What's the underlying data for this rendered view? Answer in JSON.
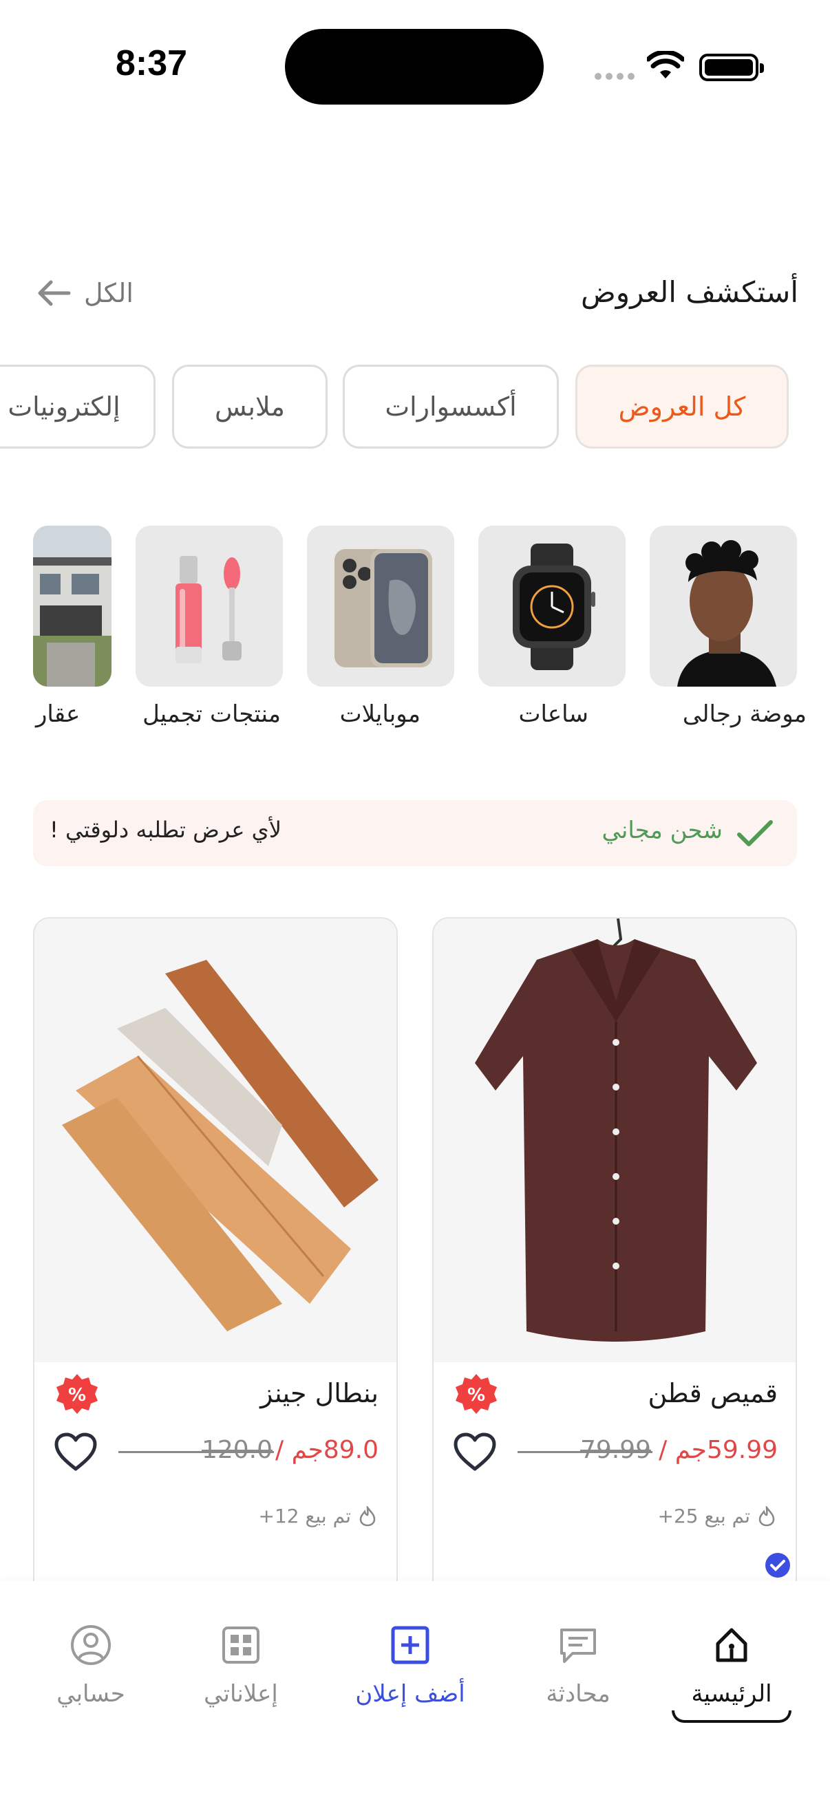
{
  "status_bar": {
    "time": "8:37"
  },
  "header": {
    "title": "أستكشف العروض",
    "see_all": "الكل"
  },
  "filters": [
    {
      "label": "كل العروض",
      "active": true
    },
    {
      "label": "أكسسوارات",
      "active": false
    },
    {
      "label": "ملابس",
      "active": false
    },
    {
      "label": "إلكترونيات",
      "active": false
    }
  ],
  "categories": [
    {
      "label": "موضة رجالى",
      "icon": "man-portrait"
    },
    {
      "label": "ساعات",
      "icon": "smart-watch"
    },
    {
      "label": "موبايلات",
      "icon": "smartphone"
    },
    {
      "label": "منتجات تجميل",
      "icon": "lip-gloss"
    },
    {
      "label": "عقار",
      "icon": "house"
    }
  ],
  "banner": {
    "title": "شحن مجاني",
    "subtitle": "لأي عرض تطلبه دلوقتي !"
  },
  "products": [
    {
      "name": "قميص قطن",
      "price": "59.99جم /",
      "old_price": "79.99",
      "sold": "تم بيع 25+",
      "image": "brown-shirt"
    },
    {
      "name": "بنطال جينز",
      "price": "89.0جم /",
      "old_price": "120.0",
      "sold": "تم بيع 12+",
      "image": "folded-pants"
    }
  ],
  "nav": {
    "home": "الرئيسية",
    "chat": "محادثة",
    "add": "أضف إعلان",
    "my_ads": "إعلاناتي",
    "account": "حسابي"
  },
  "colors": {
    "accent": "#ea5a1c",
    "price": "#e24747",
    "free_shipping": "#4f9a55",
    "nav_add": "#3b4ee0",
    "badge": "#ef3f3f"
  }
}
